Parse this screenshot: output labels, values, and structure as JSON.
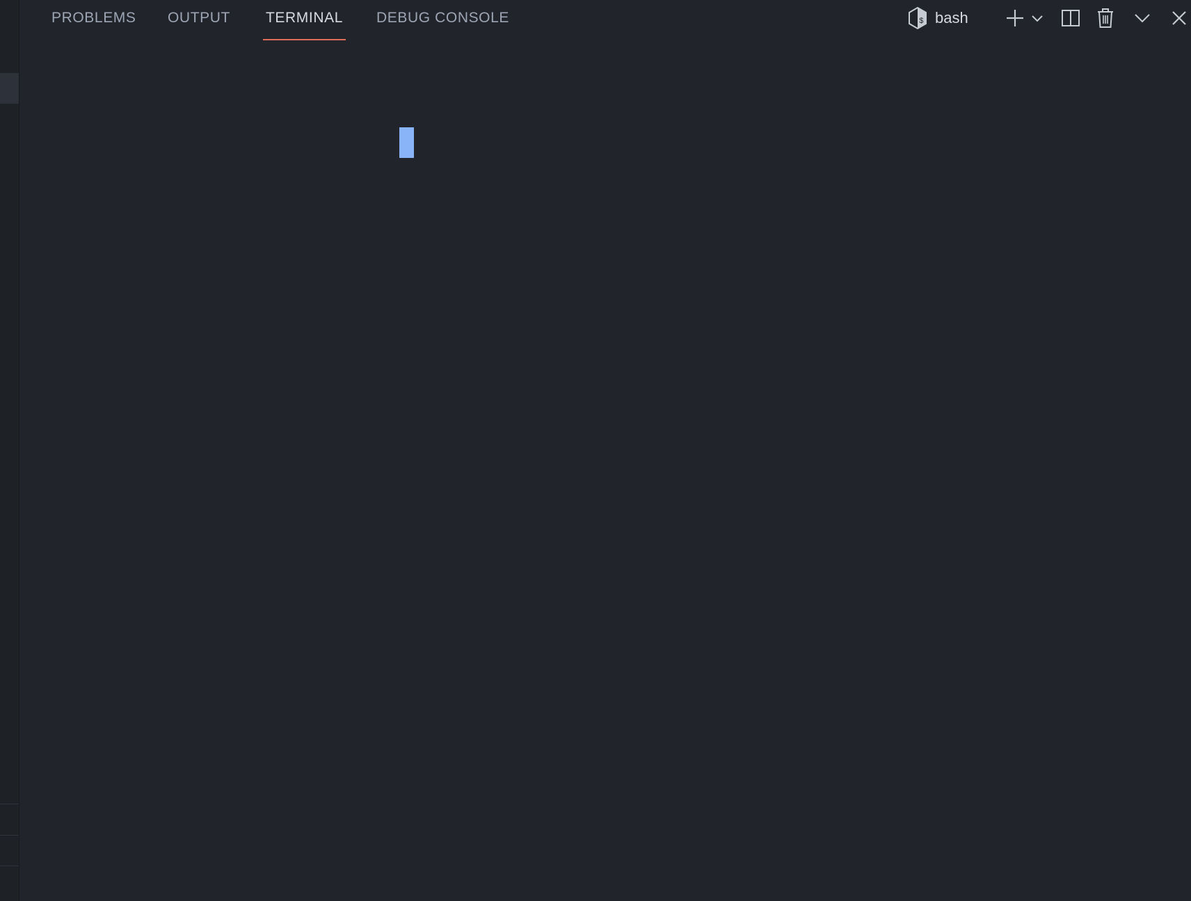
{
  "panel": {
    "tabs": [
      {
        "label": "PROBLEMS",
        "active": false
      },
      {
        "label": "OUTPUT",
        "active": false
      },
      {
        "label": "TERMINAL",
        "active": true
      },
      {
        "label": "DEBUG CONSOLE",
        "active": false
      }
    ],
    "active_tab_accent": "#e06c5a",
    "actions": {
      "shell_icon": "terminal-bash-icon",
      "shell_label": "bash",
      "new_terminal_icon": "plus-icon",
      "launch_profile_icon": "chevron-down-icon",
      "split_icon": "split-horizontal-icon",
      "kill_icon": "trash-icon",
      "maximize_icon": "chevron-down-icon",
      "close_icon": "close-icon"
    }
  },
  "terminal": {
    "content": "",
    "cursor_color": "#89b4f8",
    "background": "#21252b"
  }
}
